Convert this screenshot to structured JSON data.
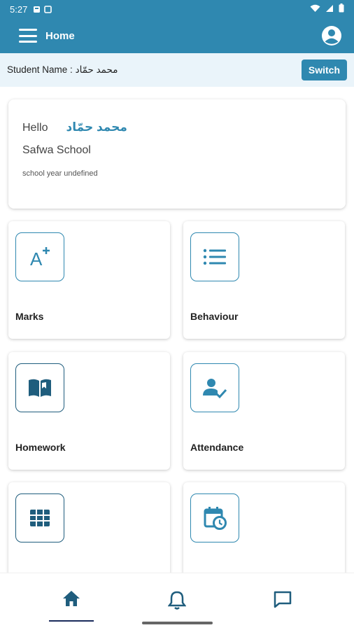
{
  "status_bar": {
    "time": "5:27"
  },
  "app_bar": {
    "title": "Home"
  },
  "student_bar": {
    "label": "Student Name : محمد حمّاد",
    "switch_label": "Switch"
  },
  "greeting": {
    "hello": "Hello",
    "name": "محمد حمّاد",
    "school": "Safwa School",
    "school_year": "school year undefined"
  },
  "tiles": [
    {
      "label": "Marks",
      "icon": "grade-a-plus-icon"
    },
    {
      "label": "Behaviour",
      "icon": "list-icon"
    },
    {
      "label": "Homework",
      "icon": "book-icon"
    },
    {
      "label": "Attendance",
      "icon": "person-check-icon"
    },
    {
      "label": "",
      "icon": "table-grid-icon"
    },
    {
      "label": "",
      "icon": "calendar-clock-icon"
    }
  ],
  "bottom_nav": [
    {
      "icon": "home-icon",
      "active": true
    },
    {
      "icon": "bell-icon",
      "active": false
    },
    {
      "icon": "chat-icon",
      "active": false
    }
  ],
  "colors": {
    "primary": "#2f88b0",
    "primary_dark": "#1f5d7d",
    "student_bar_bg": "#eaf4fa",
    "nav_active": "#1a2b5c"
  }
}
